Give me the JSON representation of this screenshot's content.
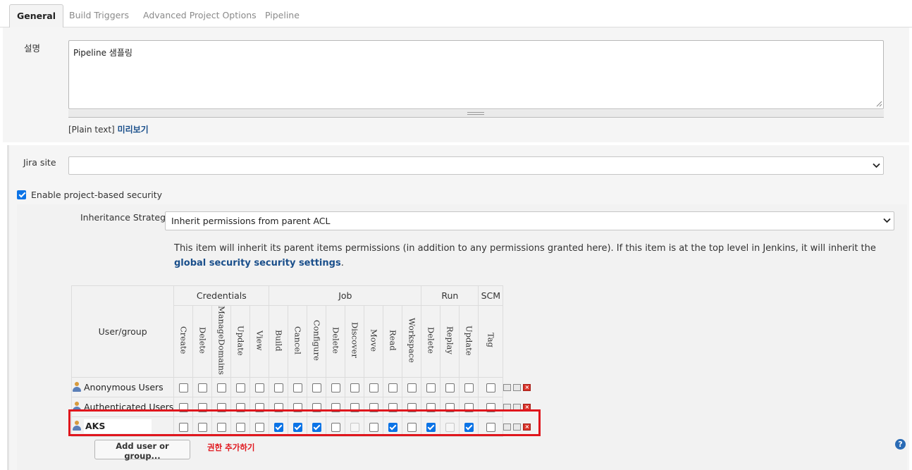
{
  "tabs": [
    {
      "label": "General",
      "active": true
    },
    {
      "label": "Build Triggers",
      "active": false
    },
    {
      "label": "Advanced Project Options",
      "active": false
    },
    {
      "label": "Pipeline",
      "active": false
    }
  ],
  "description": {
    "label": "설명",
    "value": "Pipeline 샘플링",
    "plain_text": "[Plain text]",
    "preview_link": "미리보기"
  },
  "jira": {
    "label": "Jira site",
    "value": ""
  },
  "security": {
    "enable_label": "Enable project-based security",
    "enabled": true,
    "inheritance_label": "Inheritance Strategy",
    "inheritance_value": "Inherit permissions from parent ACL",
    "info_text": "This item will inherit its parent items permissions (in addition to any permissions granted here). If this item is at the top level in Jenkins, it will inherit the ",
    "info_link": "global security security settings",
    "info_end": "."
  },
  "matrix": {
    "user_group_header": "User/group",
    "groups": [
      {
        "name": "Credentials",
        "span": 5
      },
      {
        "name": "Job",
        "span": 8
      },
      {
        "name": "Run",
        "span": 3
      },
      {
        "name": "SCM",
        "span": 1
      }
    ],
    "permissions": [
      "Create",
      "Delete",
      "ManageDomains",
      "Update",
      "View",
      "Build",
      "Cancel",
      "Configure",
      "Delete",
      "Discover",
      "Move",
      "Read",
      "Workspace",
      "Delete",
      "Replay",
      "Update",
      "Tag"
    ],
    "rows": [
      {
        "name": "Anonymous Users",
        "bold": false,
        "values": [
          0,
          0,
          0,
          0,
          0,
          0,
          0,
          0,
          0,
          0,
          0,
          0,
          0,
          0,
          0,
          0,
          0
        ]
      },
      {
        "name": "Authenticated Users",
        "bold": false,
        "values": [
          0,
          0,
          0,
          0,
          0,
          0,
          0,
          0,
          0,
          0,
          0,
          0,
          0,
          0,
          0,
          0,
          0
        ]
      },
      {
        "name": "AKS",
        "bold": true,
        "values": [
          0,
          0,
          0,
          0,
          0,
          1,
          1,
          1,
          0,
          -1,
          0,
          1,
          0,
          1,
          -1,
          1,
          0
        ]
      }
    ]
  },
  "add_button_label": "Add user or group...",
  "annotation": "권한 추가하기",
  "help_icon_glyph": "?",
  "colors": {
    "accent": "#0b73e6",
    "link": "#1a4f8b",
    "highlight": "#e0161d"
  }
}
